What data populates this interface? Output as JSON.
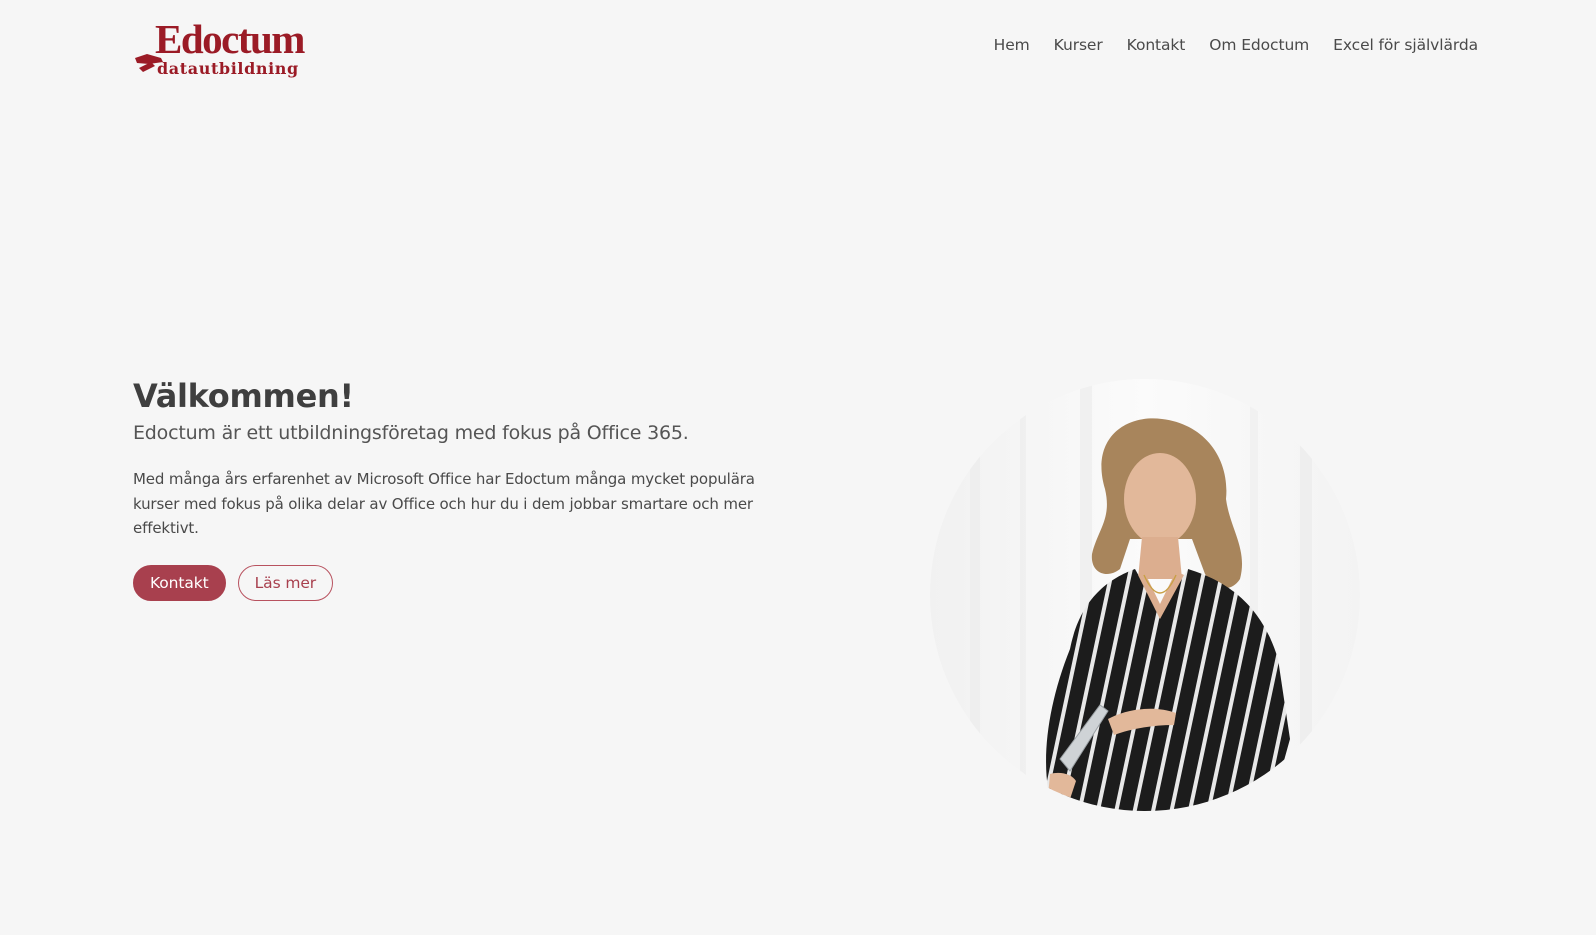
{
  "brand": {
    "logo_name": "Edoctum",
    "logo_tagline": "datautbildning",
    "accent_color": "#a8404e",
    "logo_color": "#9b1b26"
  },
  "nav": {
    "items": [
      {
        "label": "Hem"
      },
      {
        "label": "Kurser"
      },
      {
        "label": "Kontakt"
      },
      {
        "label": "Om Edoctum"
      },
      {
        "label": "Excel för självlärda"
      }
    ]
  },
  "hero": {
    "title": "Välkommen!",
    "subtitle": "Edoctum är ett utbildningsföretag med fokus på Office 365.",
    "body": "Med många års erfarenhet av Microsoft Office har Edoctum många mycket populära kurser med fokus på olika delar av Office och hur du i dem jobbar smartare och mer effektivt.",
    "primary_button": "Kontakt",
    "secondary_button": "Läs mer"
  }
}
